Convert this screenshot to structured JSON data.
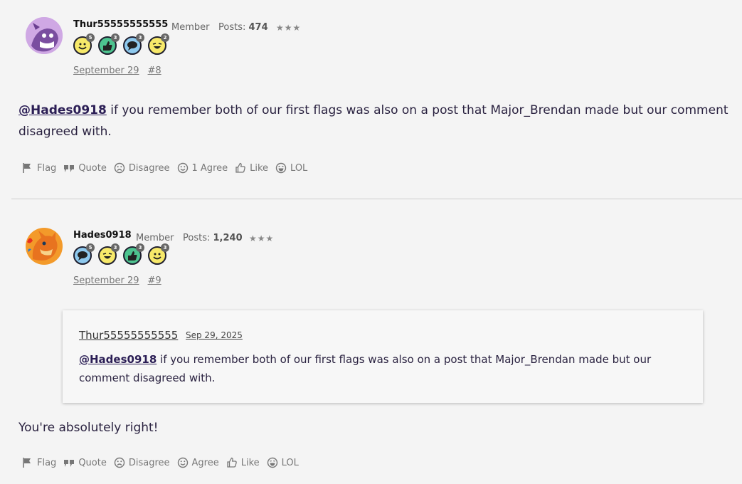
{
  "posts": [
    {
      "author": "Thur55555555555",
      "role": "Member",
      "posts_label": "Posts:",
      "posts_count": "474",
      "stars": "★★★",
      "badges": [
        {
          "icon": "smile-badge-icon",
          "color": "#f7e96a",
          "count": "5"
        },
        {
          "icon": "thumbs-badge-icon",
          "color": "#4dc38f",
          "count": "3"
        },
        {
          "icon": "chat-badge-icon",
          "color": "#8ec9ee",
          "count": "3"
        },
        {
          "icon": "laugh-badge-icon",
          "color": "#f7e96a",
          "count": "2"
        }
      ],
      "date": "September 29",
      "number": "#8",
      "mention": "@Hades0918",
      "text": " if you remember both of our first flags was also on a post that Major_Brendan made but our comment disagreed with.",
      "actions": {
        "flag": "Flag",
        "quote": "Quote",
        "disagree": "Disagree",
        "agree": "1 Agree",
        "like": "Like",
        "lol": "LOL"
      }
    },
    {
      "author": "Hades0918",
      "role": "Member",
      "posts_label": "Posts:",
      "posts_count": "1,240",
      "stars": "★★★",
      "badges": [
        {
          "icon": "chat-badge-icon",
          "color": "#8ec9ee",
          "count": "5"
        },
        {
          "icon": "laugh-badge-icon",
          "color": "#f7e96a",
          "count": "3"
        },
        {
          "icon": "thumbs-badge-icon",
          "color": "#4dc38f",
          "count": "3"
        },
        {
          "icon": "smile-badge-icon",
          "color": "#f7e96a",
          "count": "3"
        }
      ],
      "date": "September 29",
      "number": "#9",
      "quote": {
        "author": "Thur55555555555",
        "date": "Sep 29, 2025",
        "mention": "@Hades0918",
        "text": " if you remember both of our first flags was also on a post that Major_Brendan made but our comment disagreed with."
      },
      "text": "You're absolutely right!",
      "actions": {
        "flag": "Flag",
        "quote": "Quote",
        "disagree": "Disagree",
        "agree": "Agree",
        "like": "Like",
        "lol": "LOL"
      }
    }
  ]
}
